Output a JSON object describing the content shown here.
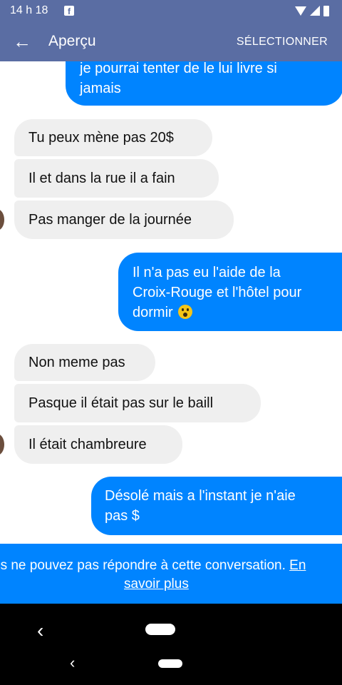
{
  "status_bar": {
    "time": "14 h 18",
    "app_icon": "facebook-icon"
  },
  "header": {
    "back_icon": "arrow-left-icon",
    "title": "Aperçu",
    "action": "SÉLECTIONNER"
  },
  "messages": [
    {
      "side": "out",
      "line1": "je pourrai tenter de le lui livre si",
      "line2": "jamais"
    },
    {
      "side": "in",
      "text": "Tu peux mène pas 20$"
    },
    {
      "side": "in",
      "text": "Il  et dans la rue il a fain"
    },
    {
      "side": "in",
      "text": "Pas manger de la journée"
    },
    {
      "side": "out",
      "line1": "Il n'a pas eu l'aide de la",
      "line2": "Croix-Rouge et l'hôtel pour",
      "line3": "dormir",
      "emoji": "astonished-face-emoji"
    },
    {
      "side": "in",
      "text": "Non meme pas"
    },
    {
      "side": "in",
      "text": "Pasque il était pas sur le baill"
    },
    {
      "side": "in",
      "text": "Il était chambreure"
    },
    {
      "side": "out",
      "line1": "Désolé mais a l'instant je n'aie",
      "line2": "pas $"
    }
  ],
  "banner": {
    "text": "us ne pouvez pas répondre à cette conversation.",
    "link_part1": "En",
    "link_part2": "savoir plus"
  },
  "colors": {
    "header": "#5a6da3",
    "outgoing": "#0084ff",
    "incoming": "#efefef"
  }
}
